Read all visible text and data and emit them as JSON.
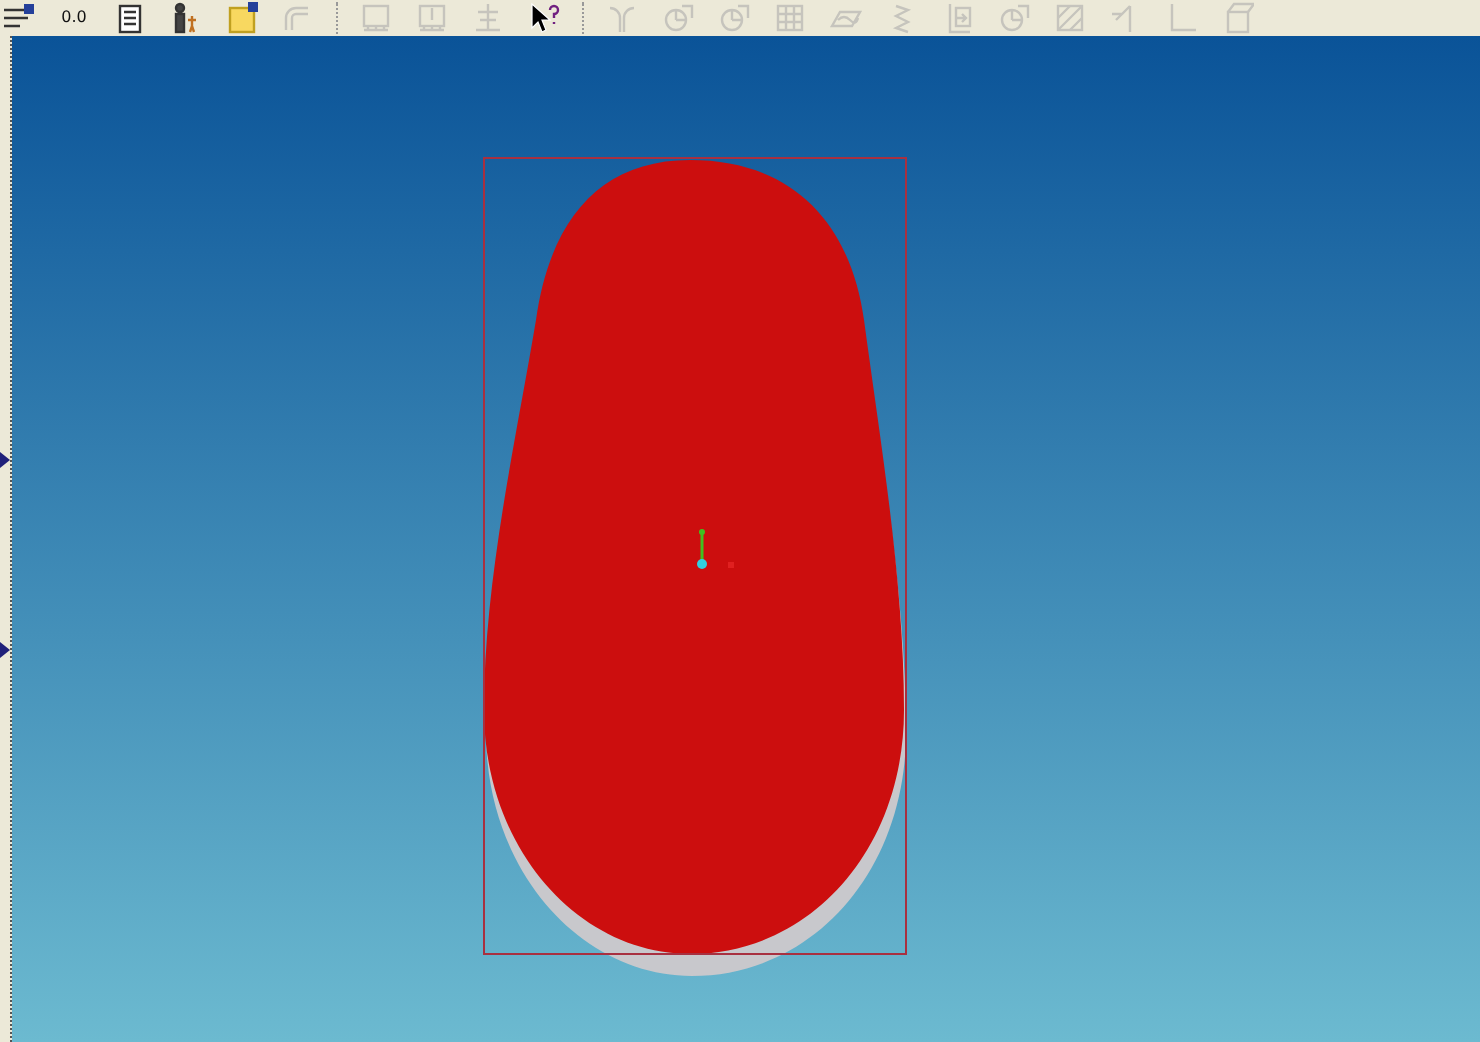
{
  "toolbar": {
    "items": [
      {
        "kind": "lines",
        "disabled": false
      },
      {
        "kind": "dimension",
        "disabled": false,
        "label": "0.0"
      },
      {
        "kind": "document",
        "disabled": false
      },
      {
        "kind": "person",
        "disabled": false
      },
      {
        "kind": "note",
        "disabled": false
      },
      {
        "kind": "pipe",
        "disabled": true
      },
      {
        "kind": "separator"
      },
      {
        "kind": "frame",
        "disabled": true
      },
      {
        "kind": "panel",
        "disabled": true
      },
      {
        "kind": "tree",
        "disabled": true
      },
      {
        "kind": "help",
        "disabled": false
      },
      {
        "kind": "separator"
      },
      {
        "kind": "arc",
        "disabled": true
      },
      {
        "kind": "circle",
        "disabled": true
      },
      {
        "kind": "circle",
        "disabled": true
      },
      {
        "kind": "grid",
        "disabled": true
      },
      {
        "kind": "surface",
        "disabled": true
      },
      {
        "kind": "spring",
        "disabled": true
      },
      {
        "kind": "insert",
        "disabled": true
      },
      {
        "kind": "circle",
        "disabled": true
      },
      {
        "kind": "hatch",
        "disabled": true
      },
      {
        "kind": "corner",
        "disabled": true
      },
      {
        "kind": "angle",
        "disabled": true
      },
      {
        "kind": "box",
        "disabled": true
      }
    ]
  }
}
